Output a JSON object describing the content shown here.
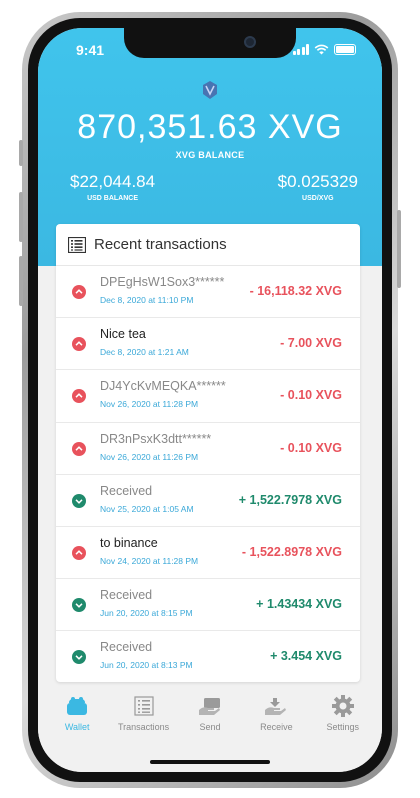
{
  "status_bar": {
    "time": "9:41"
  },
  "header": {
    "balance": "870,351.63 XVG",
    "balance_label": "XVG BALANCE",
    "usd_balance": "$22,044.84",
    "usd_balance_label": "USD BALANCE",
    "rate": "$0.025329",
    "rate_label": "USD/XVG"
  },
  "transactions": {
    "title": "Recent transactions",
    "items": [
      {
        "name": "DPEgHsW1Sox3******",
        "date": "Dec 8, 2020 at 11:10 PM",
        "amount": "- 16,118.32 XVG",
        "direction": "out"
      },
      {
        "name": "Nice tea",
        "date": "Dec 8, 2020 at 1:21 AM",
        "amount": "- 7.00 XVG",
        "direction": "out"
      },
      {
        "name": "DJ4YcKvMEQKA******",
        "date": "Nov 26, 2020 at 11:28 PM",
        "amount": "- 0.10 XVG",
        "direction": "out"
      },
      {
        "name": "DR3nPsxK3dtt******",
        "date": "Nov 26, 2020 at 11:26 PM",
        "amount": "- 0.10 XVG",
        "direction": "out"
      },
      {
        "name": "Received",
        "date": "Nov 25, 2020 at 1:05 AM",
        "amount": "+ 1,522.7978 XVG",
        "direction": "in"
      },
      {
        "name": "to binance",
        "date": "Nov 24, 2020 at 11:28 PM",
        "amount": "- 1,522.8978 XVG",
        "direction": "out"
      },
      {
        "name": "Received",
        "date": "Jun 20, 2020 at 8:15 PM",
        "amount": "+ 1.43434 XVG",
        "direction": "in"
      },
      {
        "name": "Received",
        "date": "Jun 20, 2020 at 8:13 PM",
        "amount": "+ 3.454 XVG",
        "direction": "in"
      }
    ]
  },
  "pager": {
    "current": 1,
    "total": 3
  },
  "tabs": [
    {
      "label": "Wallet",
      "icon": "wallet-icon",
      "active": true
    },
    {
      "label": "Transactions",
      "icon": "transactions-icon",
      "active": false
    },
    {
      "label": "Send",
      "icon": "send-icon",
      "active": false
    },
    {
      "label": "Receive",
      "icon": "receive-icon",
      "active": false
    },
    {
      "label": "Settings",
      "icon": "gear-icon",
      "active": false
    }
  ],
  "colors": {
    "accent": "#3bb8e2",
    "negative": "#e8525c",
    "positive": "#1f8a6c"
  }
}
